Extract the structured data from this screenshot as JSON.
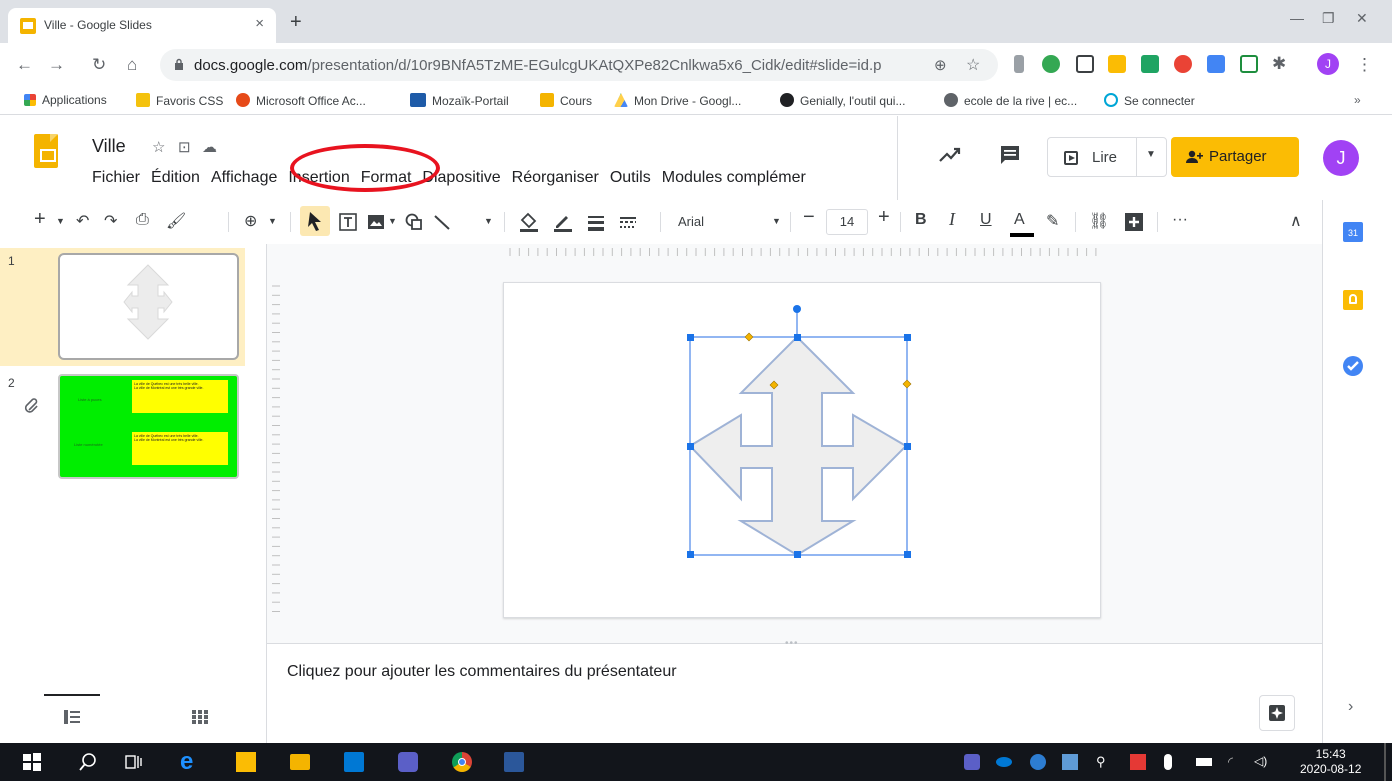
{
  "browser": {
    "tab_title": "Ville - Google Slides",
    "tab_close": "×",
    "new_tab": "+",
    "url_domain": "docs.google.com",
    "url_path": "/presentation/d/10r9BNfA5TzME-EGulcgUKAtQXPe82Cnlkwa5x6_Cidk/edit#slide=id.p",
    "profile_initial": "J",
    "bookmarks_more": "»"
  },
  "bookmarks": [
    {
      "label": "Applications",
      "icon": "apps-grid-icon",
      "color": "#4285f4"
    },
    {
      "label": "Favoris CSS",
      "icon": "folder-icon",
      "color": "#f4c20d"
    },
    {
      "label": "Microsoft Office Ac...",
      "icon": "office-icon",
      "color": "#e64a19"
    },
    {
      "label": "Mozaïk-Portail",
      "icon": "mozaik-icon",
      "color": "#1e5ba8"
    },
    {
      "label": "Cours",
      "icon": "classroom-icon",
      "color": "#f4b400"
    },
    {
      "label": "Mon Drive - Googl...",
      "icon": "drive-icon",
      "color": "#1fa463"
    },
    {
      "label": "Genially, l'outil qui...",
      "icon": "genially-icon",
      "color": "#202124"
    },
    {
      "label": "ecole de la rive | ec...",
      "icon": "globe-icon",
      "color": "#5f6368"
    },
    {
      "label": "Se connecter",
      "icon": "power-icon",
      "color": "#00a6d6"
    }
  ],
  "app": {
    "doc_title": "Ville",
    "menu": [
      "Fichier",
      "Édition",
      "Affichage",
      "Insertion",
      "Format",
      "Diapositive",
      "Réorganiser",
      "Outils",
      "Modules complémer"
    ],
    "present_label": "Lire",
    "share_label": "Partager",
    "avatar_initial": "J",
    "accent": "#fbbc04"
  },
  "toolbar": {
    "font_name": "Arial",
    "font_size": "14",
    "bold": "B",
    "italic": "I",
    "underline": "U",
    "text_color": "A",
    "more": "···"
  },
  "filmstrip": {
    "slides": [
      {
        "number": "1"
      },
      {
        "number": "2",
        "box1_items": [
          "La ville de Québec est une très belle ville.",
          "La ville de Montréal est une très grande ville."
        ],
        "box1_label": "Liste à puces",
        "box2_items": [
          "La ville de Québec est une très belle ville.",
          "La ville de Montréal est une très grande ville."
        ],
        "box2_label": "Liste numérotée",
        "bg": "#00ee00"
      }
    ]
  },
  "notes": {
    "placeholder": "Cliquez pour ajouter les commentaires du présentateur"
  },
  "side_panel": {
    "calendar_day": "31"
  },
  "taskbar": {
    "time": "15:43",
    "date": "2020-08-12"
  }
}
